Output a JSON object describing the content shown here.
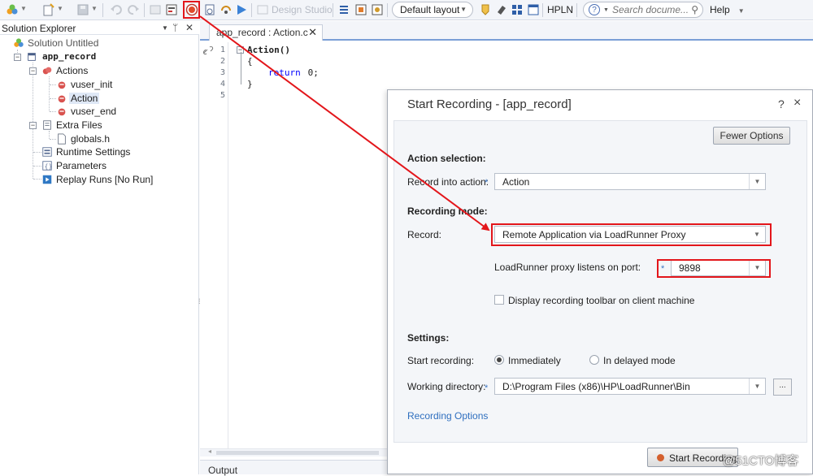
{
  "toolbar": {
    "design_studio_label": "Design Studio",
    "layout_select_value": "Default layout",
    "hpln_label": "HPLN",
    "search_placeholder": "Search docume...",
    "help_label": "Help"
  },
  "explorer": {
    "title": "Solution Explorer",
    "tree": {
      "solution": "Solution Untitled",
      "script": "app_record",
      "actions_folder": "Actions",
      "actions": [
        "vuser_init",
        "Action",
        "vuser_end"
      ],
      "extra_files_folder": "Extra Files",
      "extra_files": [
        "globals.h"
      ],
      "runtime_settings": "Runtime Settings",
      "parameters": "Parameters",
      "replay_runs": "Replay Runs [No Run]"
    }
  },
  "editor": {
    "tab_label": "app_record : Action.c",
    "line_numbers": [
      "1",
      "2",
      "3",
      "4",
      "5"
    ],
    "code": {
      "line1": "Action()",
      "line2": "{",
      "line3_kw": "return",
      "line3_rest": " 0;",
      "line4": "}"
    }
  },
  "output_label": "Output",
  "dialog": {
    "title": "Start Recording - [app_record]",
    "help_glyph": "?",
    "close_glyph": "×",
    "fewer_options_label": "Fewer Options",
    "action_selection": {
      "heading": "Action selection:",
      "record_into_label": "Record into action:",
      "record_into_value": "Action"
    },
    "recording_mode": {
      "heading": "Recording mode:",
      "record_label": "Record:",
      "record_value": "Remote Application via LoadRunner Proxy",
      "port_label": "LoadRunner proxy listens on port:",
      "port_value": "9898",
      "toolbar_checkbox_label": "Display recording toolbar on client machine",
      "toolbar_checkbox_checked": false
    },
    "settings": {
      "heading": "Settings:",
      "start_recording_label": "Start recording:",
      "immediately_label": "Immediately",
      "delayed_label": "In delayed mode",
      "selected": "Immediately",
      "working_dir_label": "Working directory:",
      "working_dir_value": "D:\\Program Files (x86)\\HP\\LoadRunner\\Bin",
      "browse_label": "..."
    },
    "recording_options_link": "Recording Options",
    "start_recording_button": "Start Recording"
  },
  "required_marker": "*",
  "watermark": "@51CTO博客",
  "colors": {
    "annotation_red": "#e3161b",
    "link_blue": "#2f6fbf",
    "required_blue": "#3a75c4"
  }
}
